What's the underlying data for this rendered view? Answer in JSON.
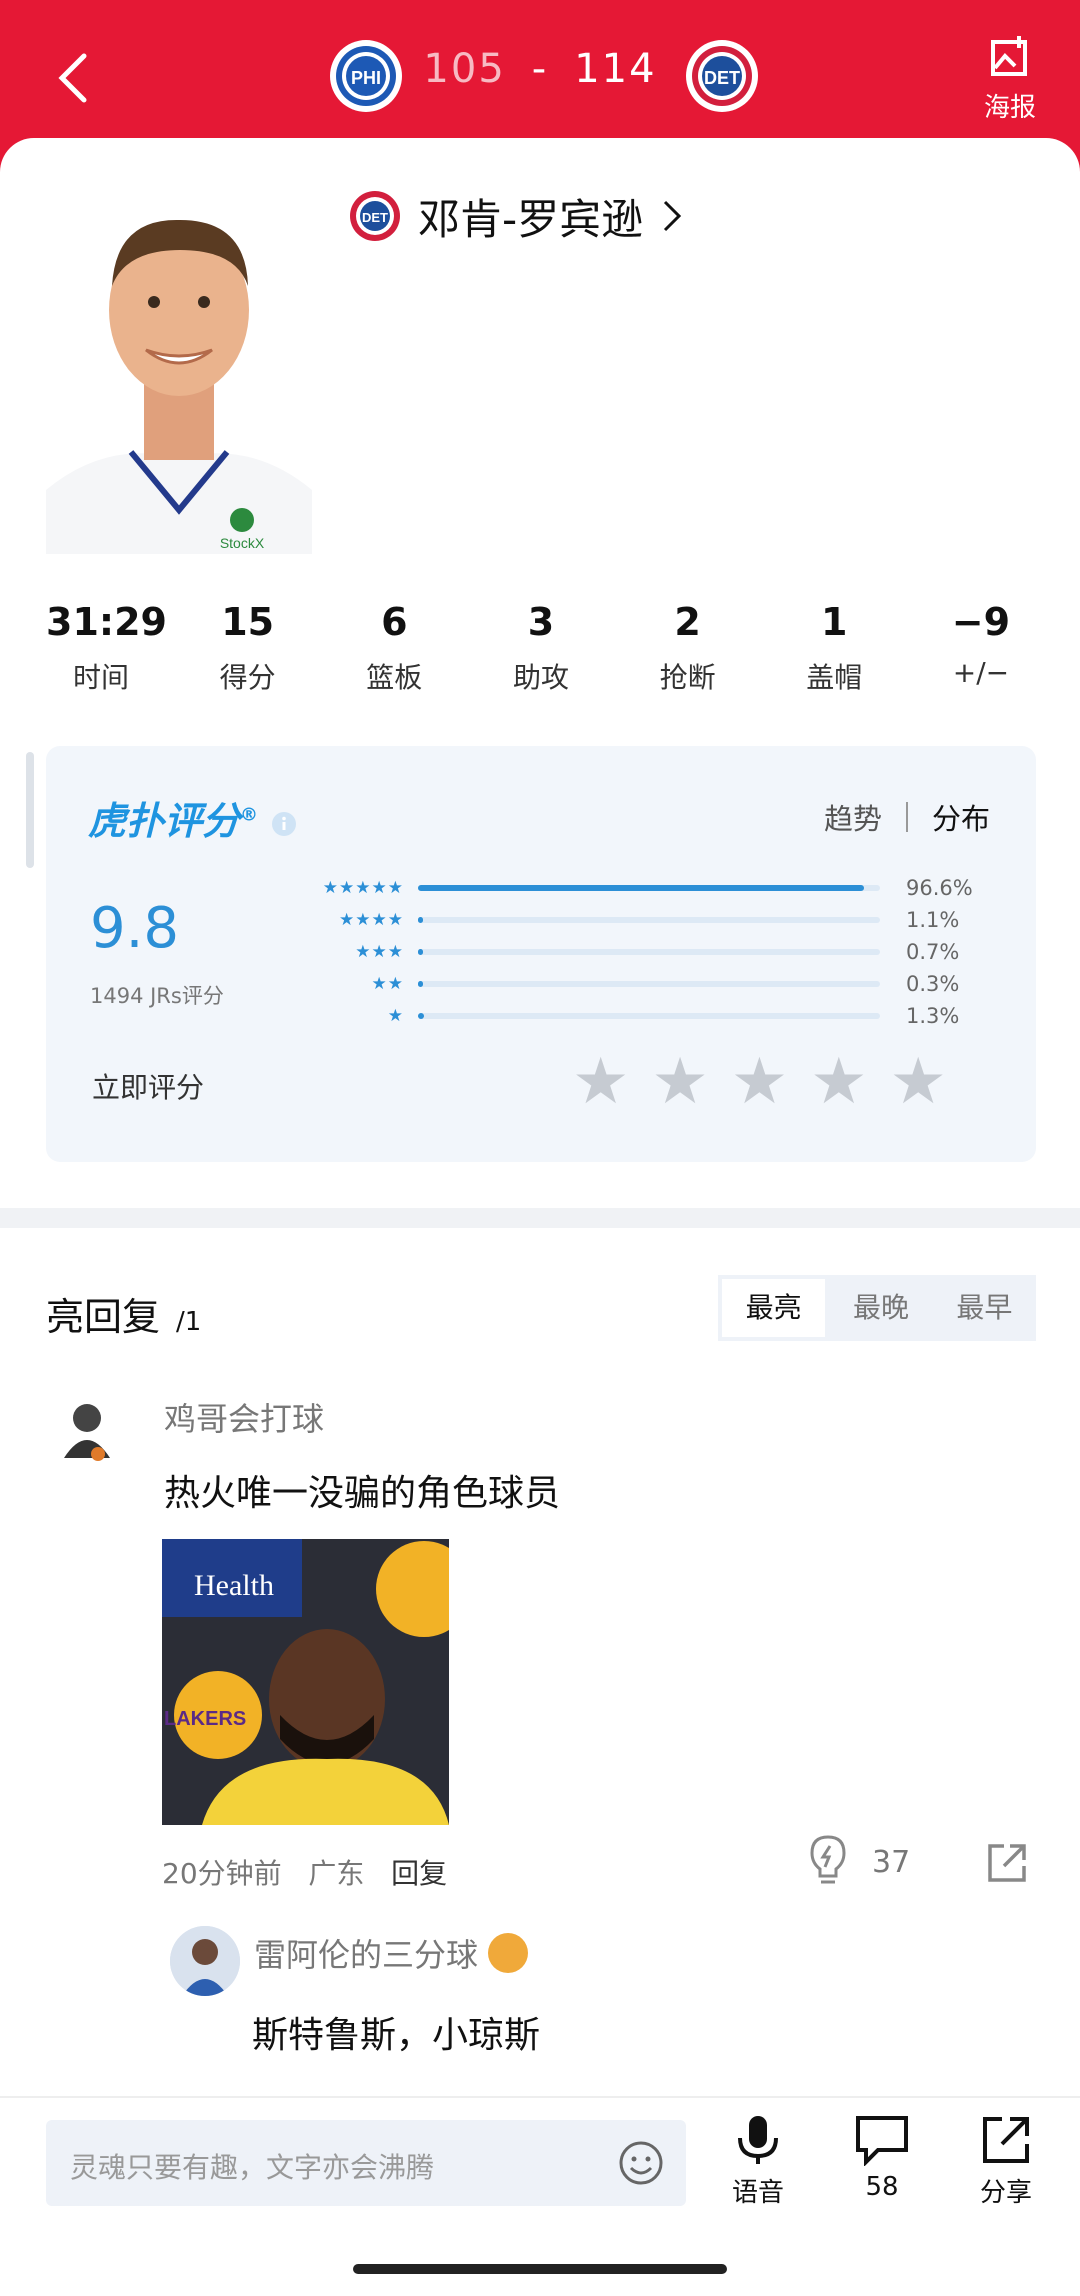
{
  "header": {
    "home_score": "105",
    "separator": "-",
    "away_score": "114",
    "home_team": "PHI",
    "away_team": "DET",
    "poster_label": "海报"
  },
  "player": {
    "name": "邓肯-罗宾逊",
    "team": "DET",
    "jersey_sponsor": "StockX"
  },
  "stats": [
    {
      "value": "31:29",
      "label": "时间"
    },
    {
      "value": "15",
      "label": "得分"
    },
    {
      "value": "6",
      "label": "篮板"
    },
    {
      "value": "3",
      "label": "助攻"
    },
    {
      "value": "2",
      "label": "抢断"
    },
    {
      "value": "1",
      "label": "盖帽"
    },
    {
      "value": "−9",
      "label": "+/−"
    }
  ],
  "rating": {
    "brand": "虎扑评分",
    "registered": "®",
    "tab_trend": "趋势",
    "tab_dist": "分布",
    "score": "9.8",
    "count": "1494 JRs评分",
    "dist": [
      {
        "stars": "★★★★★",
        "pct": "96.6%",
        "fraction": 0.966
      },
      {
        "stars": "★★★★",
        "pct": "1.1%",
        "fraction": 0.011
      },
      {
        "stars": "★★★",
        "pct": "0.7%",
        "fraction": 0.007
      },
      {
        "stars": "★★",
        "pct": "0.3%",
        "fraction": 0.003
      },
      {
        "stars": "★",
        "pct": "1.3%",
        "fraction": 0.013
      }
    ],
    "rate_now": "立即评分"
  },
  "replies": {
    "title": "亮回复",
    "count": "/1",
    "sort": [
      "最亮",
      "最晚",
      "最早"
    ],
    "main": {
      "user": "鸡哥会打球",
      "text": "热火唯一没骗的角色球员",
      "image_text_1": "Health",
      "image_text_2": "LAKERS",
      "time": "20分钟前",
      "location": "广东",
      "reply_label": "回复",
      "likes": "37"
    },
    "sub": {
      "user": "雷阿伦的三分球",
      "text": "斯特鲁斯，小琼斯"
    }
  },
  "bottom": {
    "placeholder": "灵魂只要有趣，文字亦会沸腾",
    "voice": "语音",
    "comments": "58",
    "share": "分享"
  }
}
